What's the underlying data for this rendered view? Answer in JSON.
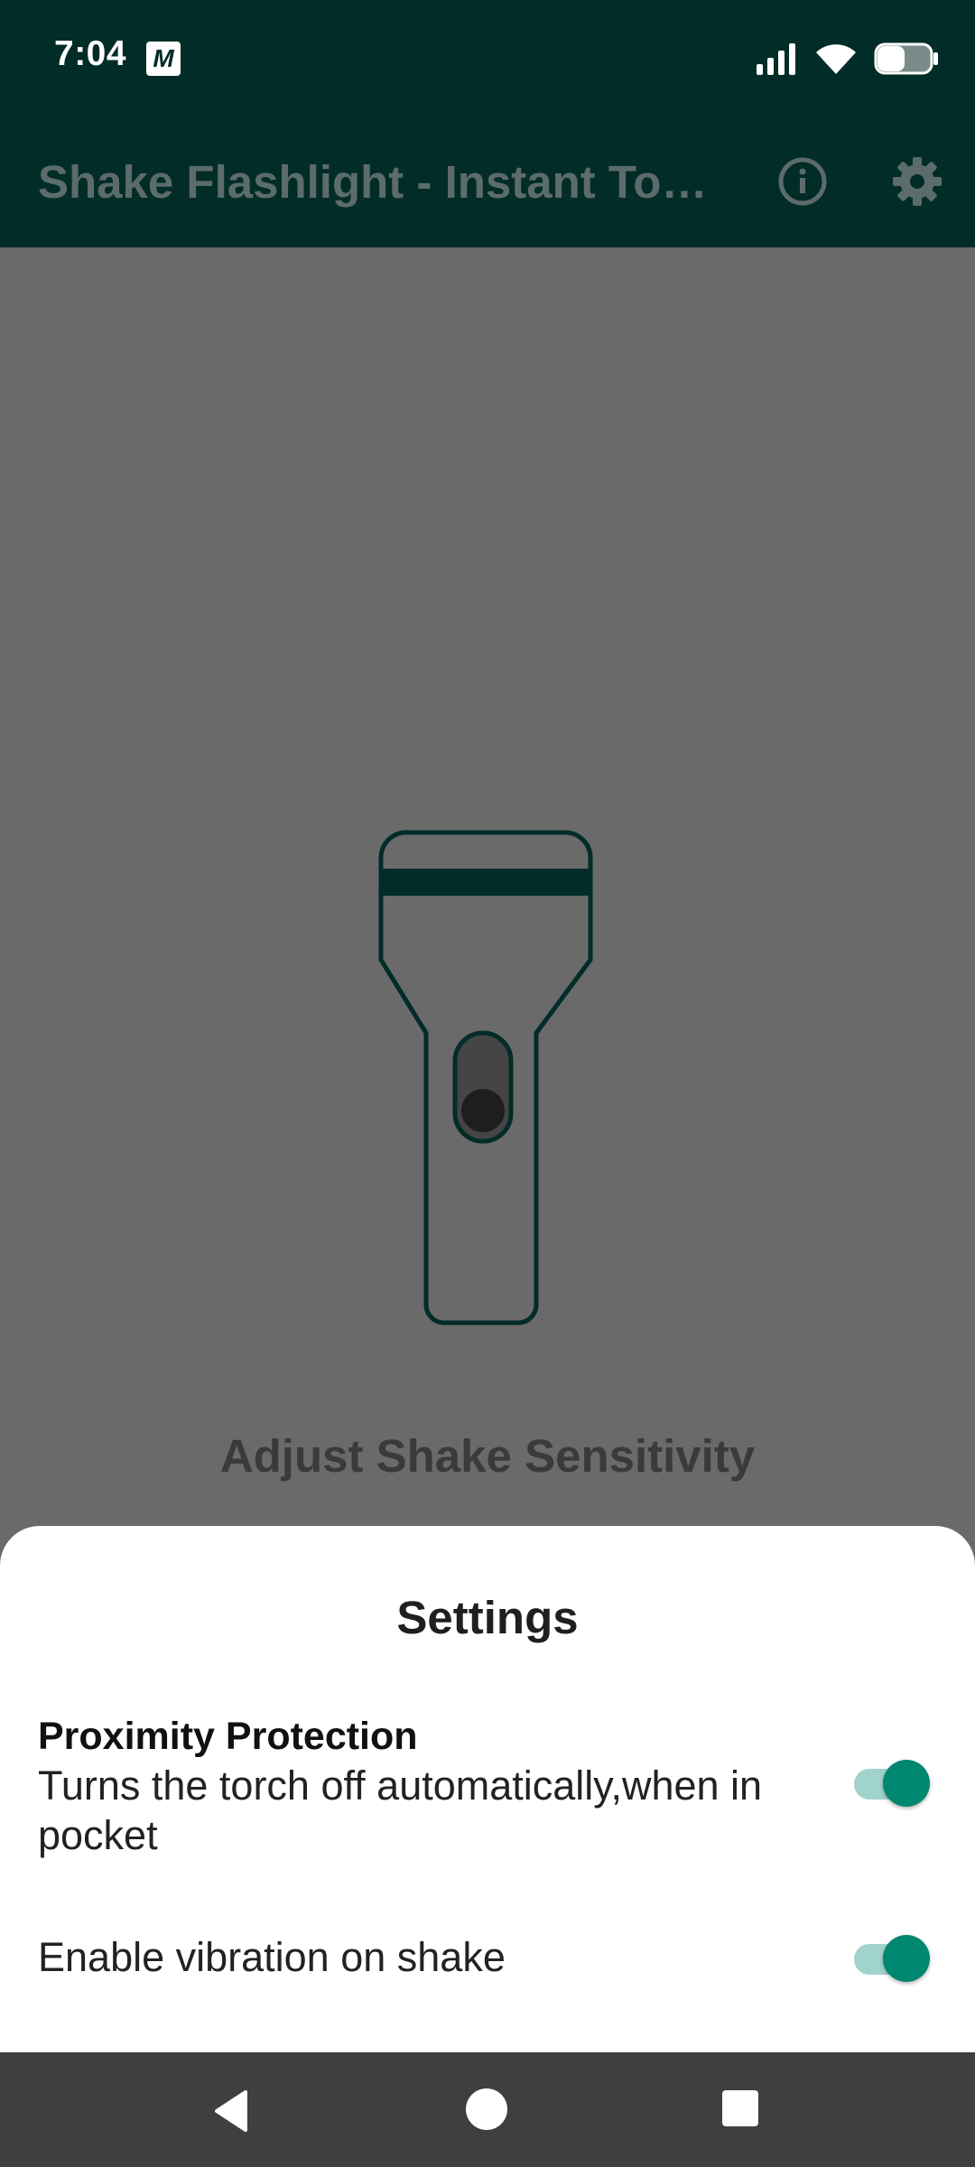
{
  "status_bar": {
    "time": "7:04",
    "notification_icon": "M",
    "icons": [
      "signal-icon",
      "wifi-icon",
      "battery-icon"
    ]
  },
  "app_bar": {
    "title": "Shake Flashlight - Instant Torch",
    "actions": [
      "info-icon",
      "gear-icon"
    ]
  },
  "main": {
    "sensitivity_label": "Adjust Shake Sensitivity"
  },
  "settings_sheet": {
    "title": "Settings",
    "proximity": {
      "title": "Proximity Protection",
      "subtitle": "Turns the torch off automatically,when in pocket",
      "enabled": true
    },
    "vibration": {
      "label": "Enable vibration on shake",
      "enabled": true
    }
  },
  "colors": {
    "app_bar": "#022c28",
    "accent": "#00876f",
    "scrim": "#6a6a6a",
    "nav_bar": "#3d403e"
  },
  "nav_bar": {
    "buttons": [
      "back-icon",
      "home-icon",
      "recents-icon"
    ]
  }
}
